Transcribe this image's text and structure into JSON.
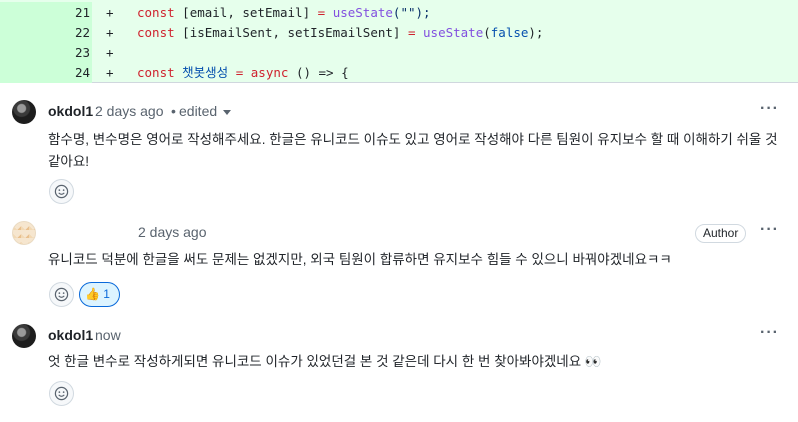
{
  "diff": {
    "lines": [
      {
        "num": "21",
        "sign": "+"
      },
      {
        "num": "22",
        "sign": "+"
      },
      {
        "num": "23",
        "sign": "+"
      },
      {
        "num": "24",
        "sign": "+"
      }
    ],
    "code": {
      "l21": {
        "kw": "const",
        "vars": "[email, setEmail]",
        "eq": "=",
        "fn": "useState",
        "args": "(\"\");"
      },
      "l22": {
        "kw": "const",
        "vars": "[isEmailSent, setIsEmailSent]",
        "eq": "=",
        "fn": "useState",
        "open": "(",
        "arg": "false",
        "close": ");"
      },
      "l24": {
        "kw": "const",
        "name": "챗봇생성",
        "eq": "=",
        "async": "async",
        "arrow": "() => {"
      }
    }
  },
  "comments": [
    {
      "author": "okdol1",
      "time": "2 days ago",
      "separator": "•",
      "edited": "edited",
      "menu": "···",
      "text": "함수명, 변수명은 영어로 작성해주세요. 한글은 유니코드 이슈도 있고 영어로 작성해야 다른 팀원이 유지보수 할 때 이해하기 쉬울 것 같아요!"
    },
    {
      "time": "2 days ago",
      "badge": "Author",
      "menu": "···",
      "text": "유니코드 덕분에 한글을 써도 문제는 없겠지만, 외국 팀원이 합류하면 유지보수 힘들 수 있으니 바꿔야겠네요ㅋㅋ",
      "reaction": {
        "emoji": "👍",
        "count": "1"
      }
    },
    {
      "author": "okdol1",
      "time": "now",
      "menu": "···",
      "text": "엇 한글 변수로 작성하게되면 유니코드 이슈가 있었던걸 본 것 같은데 다시 한 번 찾아봐야겠네요 👀"
    }
  ],
  "colors": {
    "diff_bg": "#e6ffec",
    "accent": "#0969da",
    "muted": "#59636e"
  }
}
